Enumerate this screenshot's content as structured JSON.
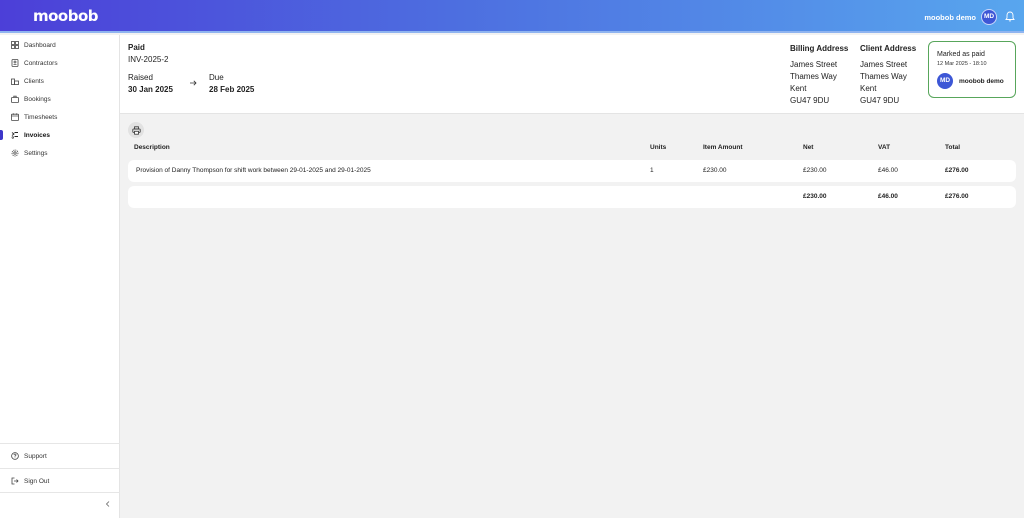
{
  "app": {
    "logo": "moobob",
    "user_name": "moobob demo",
    "user_initials": "MD"
  },
  "sidebar": {
    "items": [
      {
        "label": "Dashboard",
        "icon": "grid-icon"
      },
      {
        "label": "Contractors",
        "icon": "id-card-icon"
      },
      {
        "label": "Clients",
        "icon": "building-icon"
      },
      {
        "label": "Bookings",
        "icon": "briefcase-icon"
      },
      {
        "label": "Timesheets",
        "icon": "calendar-icon"
      },
      {
        "label": "Invoices",
        "icon": "receipt-icon",
        "active": true
      },
      {
        "label": "Settings",
        "icon": "gear-icon"
      }
    ],
    "support": "Support",
    "sign_out": "Sign Out"
  },
  "invoice": {
    "status": "Paid",
    "number": "INV-2025-2",
    "raised_label": "Raised",
    "raised_date": "30 Jan 2025",
    "due_label": "Due",
    "due_date": "28 Feb 2025",
    "billing": {
      "title": "Billing Address",
      "lines": [
        "James Street",
        "Thames Way",
        "Kent",
        "GU47 9DU"
      ]
    },
    "client": {
      "title": "Client Address",
      "lines": [
        "James Street",
        "Thames Way",
        "Kent",
        "GU47 9DU"
      ]
    },
    "paid_card": {
      "title": "Marked as paid",
      "date": "12 Mar 2025 - 18:10",
      "user_initials": "MD",
      "user_name": "moobob demo"
    }
  },
  "table": {
    "headers": {
      "description": "Description",
      "units": "Units",
      "item_amount": "Item Amount",
      "net": "Net",
      "vat": "VAT",
      "total": "Total"
    },
    "rows": [
      {
        "description": "Provision of Danny Thompson for shift work between 29-01-2025 and 29-01-2025",
        "units": "1",
        "item_amount": "£230.00",
        "net": "£230.00",
        "vat": "£46.00",
        "total": "£276.00"
      }
    ],
    "totals": {
      "net": "£230.00",
      "vat": "£46.00",
      "total": "£276.00"
    }
  },
  "colors": {
    "accent": "#3d36c9",
    "paid_border": "#58a65b",
    "avatar": "#3d57d6"
  }
}
